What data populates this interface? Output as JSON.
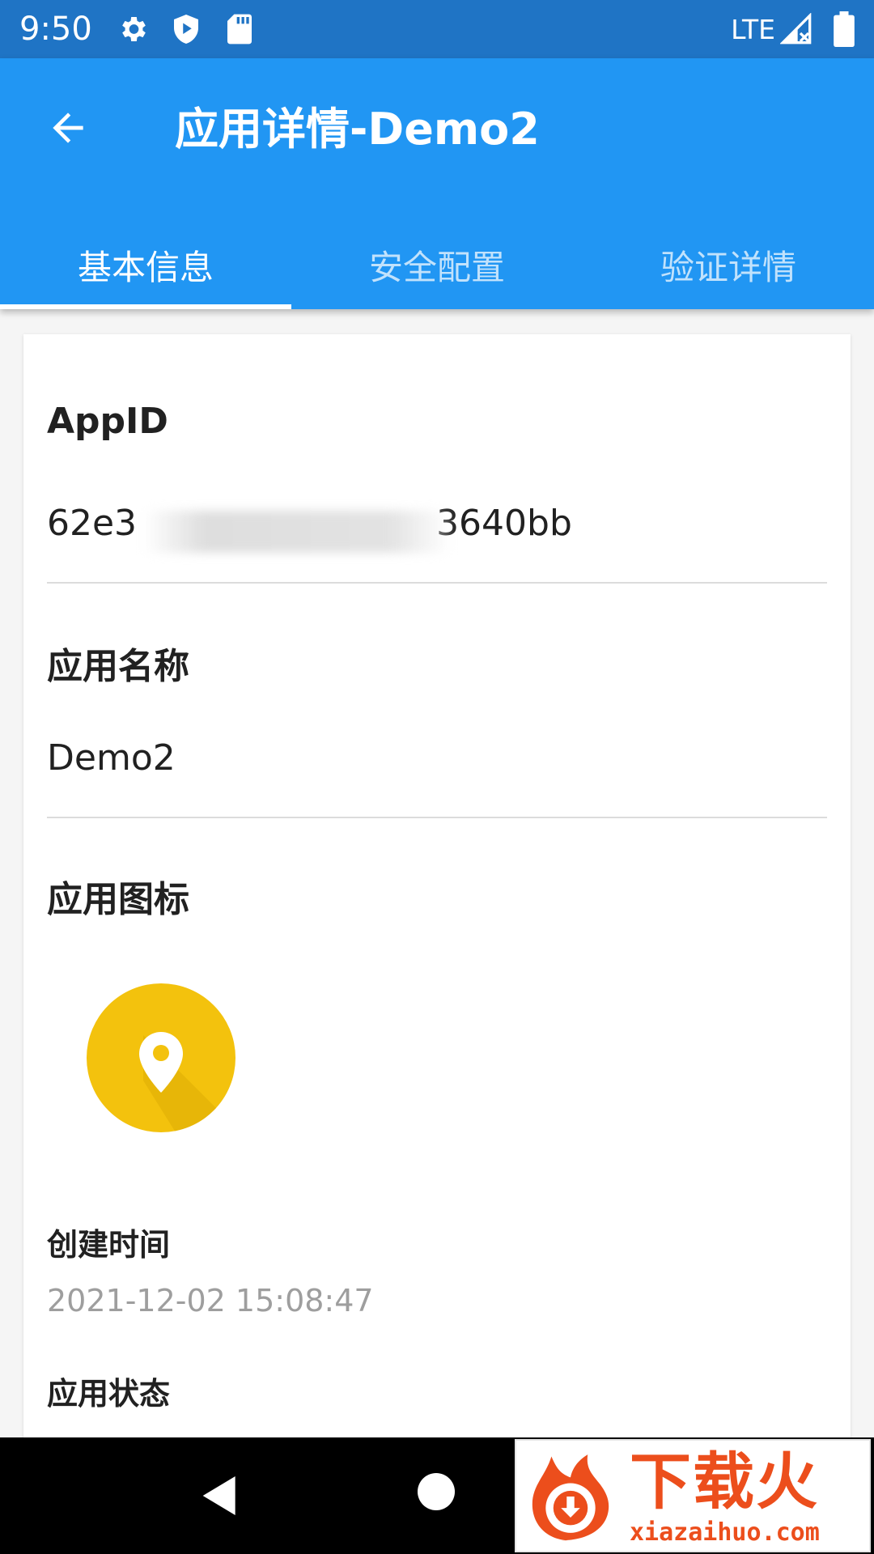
{
  "status_bar": {
    "time": "9:50",
    "network": "LTE",
    "icons": [
      "gear-icon",
      "shield-play-icon",
      "sd-card-icon",
      "signal-icon",
      "battery-icon"
    ]
  },
  "app_bar": {
    "title": "应用详情-Demo2",
    "back_icon": "arrow-left-icon"
  },
  "tabs": [
    {
      "label": "基本信息",
      "active": true
    },
    {
      "label": "安全配置",
      "active": false
    },
    {
      "label": "验证详情",
      "active": false
    }
  ],
  "details": {
    "appid_label": "AppID",
    "appid_value_start": "62e3",
    "appid_value_end": "3640bb",
    "name_label": "应用名称",
    "name_value": "Demo2",
    "icon_label": "应用图标",
    "created_label": "创建时间",
    "created_value": "2021-12-02 15:08:47",
    "status_label": "应用状态"
  },
  "watermark": {
    "text": "下载火",
    "url": "xiazaihuo.com"
  },
  "colors": {
    "status_bar": "#1f74c5",
    "app_bar": "#2196f3",
    "icon_background": "#f3c20d",
    "watermark": "#ec4e1c"
  }
}
